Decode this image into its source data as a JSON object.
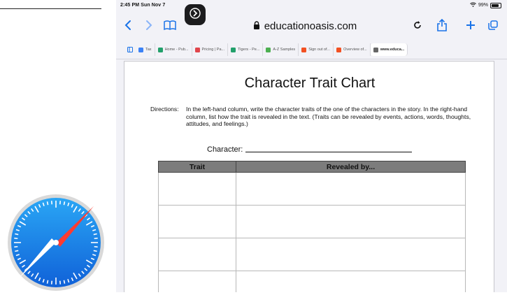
{
  "status": {
    "time": "2:45 PM",
    "date": "Sun Nov 7",
    "battery": "99%"
  },
  "browser": {
    "url": "educationoasis.com",
    "tabs": [
      {
        "label": "Tax",
        "color": "#3b82f6"
      },
      {
        "label": "Home - Pub...",
        "color": "#22a06b"
      },
      {
        "label": "Pricing | Pa...",
        "color": "#e0454b"
      },
      {
        "label": "Tigers - Pe...",
        "color": "#22a06b"
      },
      {
        "label": "A-Z Samples",
        "color": "#4caf50"
      },
      {
        "label": "Sign out of...",
        "color": "#f25022"
      },
      {
        "label": "Overview of...",
        "color": "#f25022"
      },
      {
        "label": "www.educa...",
        "color": "#666666"
      }
    ]
  },
  "document": {
    "title": "Character Trait Chart",
    "directions_label": "Directions:",
    "directions_text": "In the left-hand column, write the character traits of the one of the characters in the story. In the right-hand column, list how the trait is revealed in the text. (Traits can be revealed by events, actions, words, thoughts, attitudes, and feelings.)",
    "character_label": "Character:",
    "table": {
      "headers": [
        "Trait",
        "Revealed by..."
      ]
    }
  }
}
